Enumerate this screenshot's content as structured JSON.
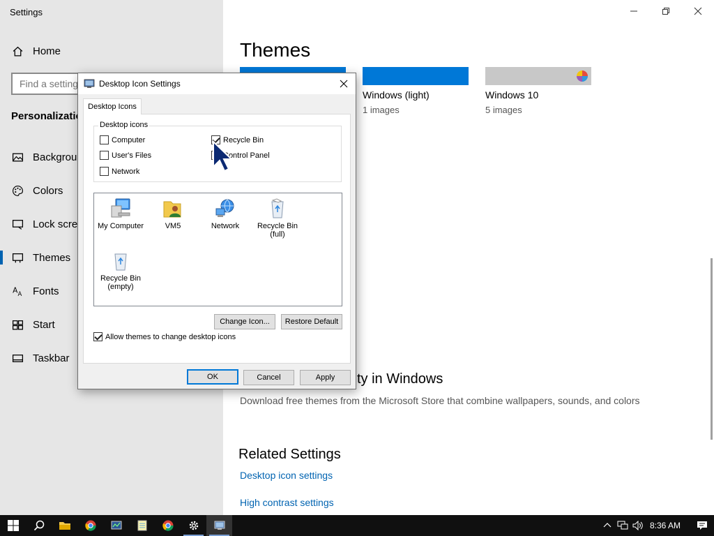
{
  "app": {
    "title": "Settings"
  },
  "sidebar": {
    "search_placeholder": "Find a setting",
    "home_label": "Home",
    "section": "Personalization",
    "items": [
      {
        "label": "Background",
        "icon": "picture-icon"
      },
      {
        "label": "Colors",
        "icon": "palette-icon"
      },
      {
        "label": "Lock screen",
        "icon": "monitor-icon"
      },
      {
        "label": "Themes",
        "icon": "brush-icon",
        "active": true
      },
      {
        "label": "Fonts",
        "icon": "font-icon"
      },
      {
        "label": "Start",
        "icon": "start-icon"
      },
      {
        "label": "Taskbar",
        "icon": "taskbar-icon"
      }
    ]
  },
  "main": {
    "title": "Themes",
    "themes": [
      {
        "name": "",
        "count": "",
        "color": "#0078d7"
      },
      {
        "name": "Windows (light)",
        "count": "1 images",
        "color": "#0078d7"
      },
      {
        "name": "Windows 10",
        "count": "5 images",
        "color": "#c8c8c8"
      }
    ],
    "more_heading": "ty in Windows",
    "more_desc": "Download free themes from the Microsoft Store that combine wallpapers, sounds, and colors",
    "related_heading": "Related Settings",
    "related_links": [
      "Desktop icon settings",
      "High contrast settings"
    ]
  },
  "dialog": {
    "title": "Desktop Icon Settings",
    "tab": "Desktop Icons",
    "group_label": "Desktop icons",
    "checkboxes": [
      {
        "label": "Computer",
        "checked": false
      },
      {
        "label": "User's Files",
        "checked": false
      },
      {
        "label": "Network",
        "checked": false
      },
      {
        "label": "Recycle Bin",
        "checked": true
      },
      {
        "label": "Control Panel",
        "checked": false
      }
    ],
    "icons": [
      {
        "label": "My Computer",
        "icon": "computer-icon"
      },
      {
        "label": "VM5",
        "icon": "user-folder-icon"
      },
      {
        "label": "Network",
        "icon": "network-icon"
      },
      {
        "label": "Recycle Bin\n(full)",
        "icon": "recycle-bin-full-icon"
      },
      {
        "label": "Recycle Bin\n(empty)",
        "icon": "recycle-bin-empty-icon"
      }
    ],
    "change_icon": "Change Icon...",
    "restore_default": "Restore Default",
    "allow_themes": "Allow themes to change desktop icons",
    "allow_checked": true,
    "ok": "OK",
    "cancel": "Cancel",
    "apply": "Apply"
  },
  "taskbar": {
    "clock": "8:36 AM",
    "apps": [
      "start-icon",
      "search-icon",
      "file-explorer-icon",
      "chrome-icon",
      "task-manager-icon",
      "notepad-icon",
      "chrome-icon",
      "settings-icon",
      "remote-desktop-icon"
    ]
  }
}
